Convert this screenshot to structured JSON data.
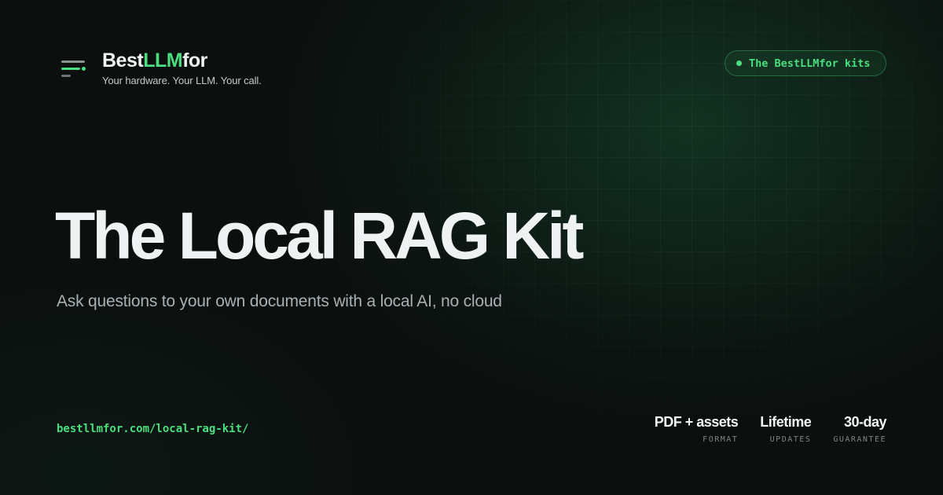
{
  "brand": {
    "name_main": "Best",
    "name_accent": "LLM",
    "name_suffix": "for",
    "tagline": "Your hardware. Your LLM. Your call.",
    "logo_icon": "menu-lines-icon"
  },
  "badge": {
    "label": "The BestLLMfor kits"
  },
  "hero": {
    "title": "The Local RAG Kit",
    "subtitle": "Ask questions to your own documents with a local AI, no cloud"
  },
  "footer": {
    "url": "bestllmfor.com/local-rag-kit/",
    "stats": [
      {
        "value": "PDF + assets",
        "label": "FORMAT"
      },
      {
        "value": "Lifetime",
        "label": "UPDATES"
      },
      {
        "value": "30-day",
        "label": "GUARANTEE"
      }
    ]
  },
  "colors": {
    "accent": "#4ade80",
    "background": "#0b0f0e",
    "title": "#eef2f3",
    "subtitle": "#a7b1b4"
  }
}
